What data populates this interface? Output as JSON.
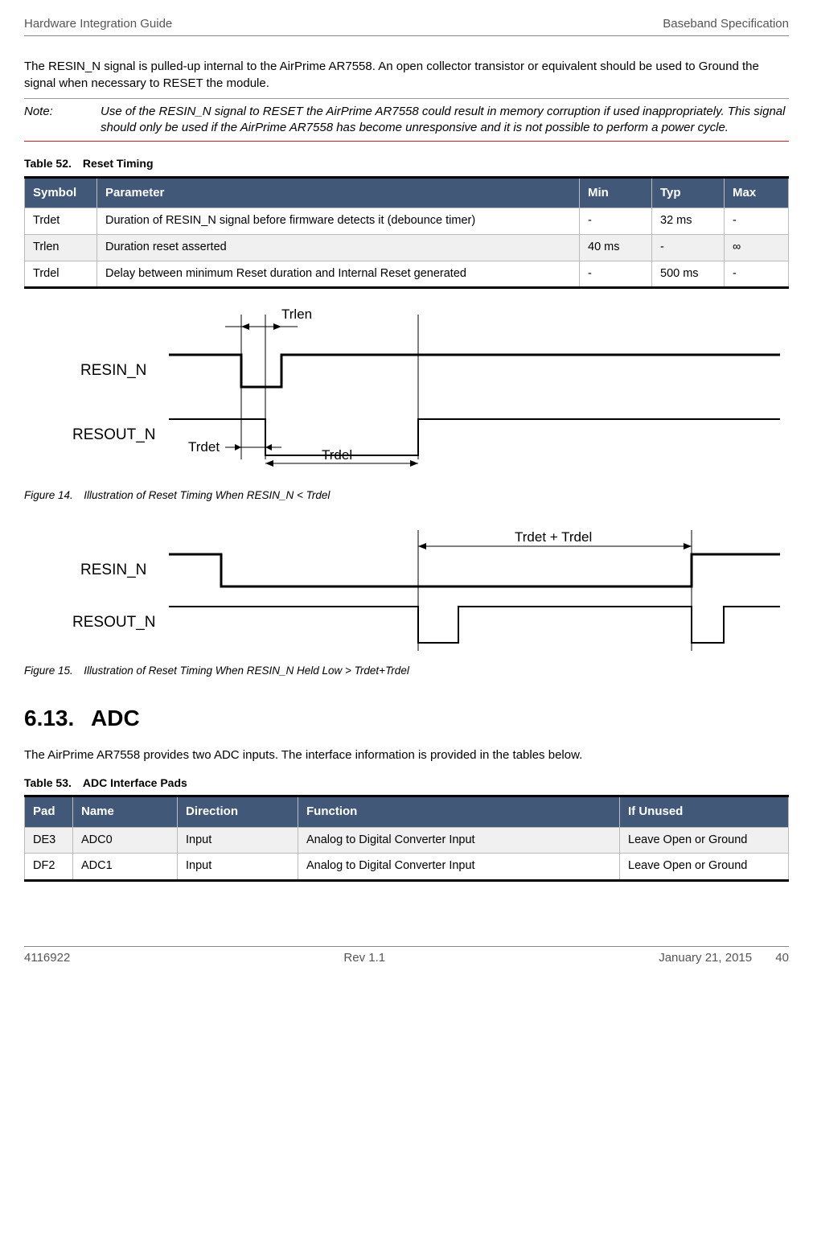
{
  "header": {
    "left": "Hardware Integration Guide",
    "right": "Baseband Specification"
  },
  "para1": "The RESIN_N signal is pulled-up internal to the AirPrime AR7558. An open collector transistor or equivalent should be used to Ground the signal when necessary to RESET the module.",
  "note": {
    "label": "Note:",
    "text": "Use of the RESIN_N signal to RESET the AirPrime AR7558 could result in memory corruption if used inappropriately. This signal should only be used if the AirPrime AR7558 has become unresponsive and it is not possible to perform a power cycle."
  },
  "table52": {
    "caption": "Table 52. Reset Timing",
    "headers": [
      "Symbol",
      "Parameter",
      "Min",
      "Typ",
      "Max"
    ],
    "rows": [
      {
        "c0": "Trdet",
        "c1": "Duration of RESIN_N signal before firmware detects it (debounce timer)",
        "c2": "-",
        "c3": "32 ms",
        "c4": "-"
      },
      {
        "c0": "Trlen",
        "c1": "Duration reset asserted",
        "c2": "40 ms",
        "c3": "-",
        "c4": "∞"
      },
      {
        "c0": "Trdel",
        "c1": "Delay between minimum Reset duration and Internal Reset generated",
        "c2": "-",
        "c3": "500 ms",
        "c4": "-"
      }
    ]
  },
  "fig14": {
    "caption": "Figure 14. Illustration of Reset Timing When RESIN_N < Trdel",
    "labels": {
      "resin": "RESIN_N",
      "resout": "RESOUT_N",
      "trlen": "Trlen",
      "trdet": "Trdet",
      "trdel": "Trdel"
    }
  },
  "fig15": {
    "caption": "Figure 15. Illustration of Reset Timing When RESIN_N Held Low > Trdet+Trdel",
    "labels": {
      "resin": "RESIN_N",
      "resout": "RESOUT_N",
      "trdet_trdel": "Trdet + Trdel"
    }
  },
  "section": {
    "heading": "6.13.  ADC",
    "para": "The AirPrime AR7558 provides two ADC inputs. The interface information is provided in the tables below."
  },
  "table53": {
    "caption": "Table 53. ADC Interface Pads",
    "headers": [
      "Pad",
      "Name",
      "Direction",
      "Function",
      "If Unused"
    ],
    "rows": [
      {
        "c0": "DE3",
        "c1": "ADC0",
        "c2": "Input",
        "c3": "Analog to Digital Converter Input",
        "c4": "Leave Open or Ground"
      },
      {
        "c0": "DF2",
        "c1": "ADC1",
        "c2": "Input",
        "c3": "Analog to Digital Converter Input",
        "c4": "Leave Open or Ground"
      }
    ]
  },
  "footer": {
    "left": "4116922",
    "mid": "Rev 1.1",
    "right1": "January 21, 2015",
    "right2": "40"
  }
}
